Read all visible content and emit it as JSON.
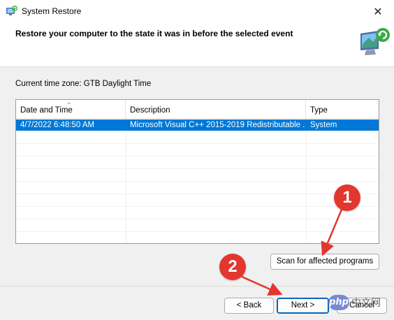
{
  "window": {
    "title": "System Restore",
    "close_glyph": "✕"
  },
  "header": {
    "title": "Restore your computer to the state it was in before the selected event"
  },
  "timezone_text": "Current time zone: GTB Daylight Time",
  "table": {
    "columns": [
      "Date and Time",
      "Description",
      "Type"
    ],
    "rows": [
      {
        "date": "4/7/2022 6:48:50 AM",
        "description": "Microsoft Visual C++ 2015-2019 Redistributable ...",
        "type": "System",
        "selected": true
      }
    ]
  },
  "buttons": {
    "scan": "Scan for affected programs",
    "back": "< Back",
    "next": "Next >",
    "cancel": "Cancel"
  },
  "callouts": [
    "1",
    "2"
  ],
  "watermark": {
    "logo": "php",
    "text": "中文网"
  },
  "colors": {
    "selection": "#0078d7",
    "callout": "#e2362f",
    "primary_border": "#0067c0"
  },
  "icons": {
    "app": "system-restore-icon",
    "header": "restore-monitor-icon",
    "close": "close-icon",
    "sort": "sort-down-arrow-icon"
  }
}
